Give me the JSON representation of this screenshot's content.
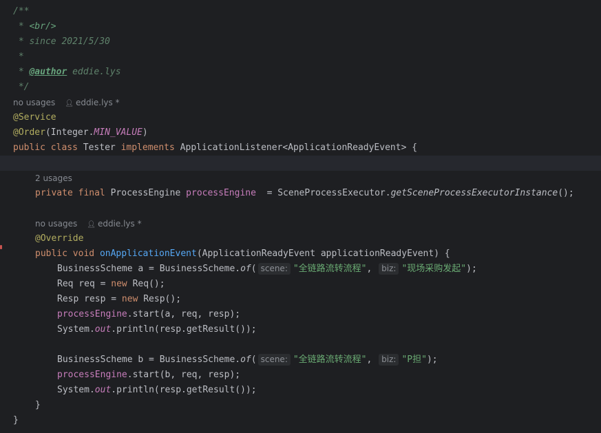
{
  "javadoc": {
    "open": "/**",
    "br_prefix": " * ",
    "br_tag": "<br/>",
    "since_line": " * since 2021/5/30",
    "blank_line": " *",
    "author_prefix": " * ",
    "author_tag": "@author",
    "author_value": " eddie.lys",
    "close": " */"
  },
  "class_inlay": {
    "usages": "no usages",
    "author": "eddie.lys *"
  },
  "annotations": {
    "service": "@Service",
    "order": "@Order",
    "order_paren_open": "(Integer.",
    "order_const": "MIN_VALUE",
    "order_paren_close": ")"
  },
  "class_decl": {
    "public": "public",
    "class": "class",
    "name": " Tester ",
    "implements": "implements",
    "rest": " ApplicationListener<ApplicationReadyEvent> {"
  },
  "field_inlay": {
    "usages": "2 usages"
  },
  "field_decl": {
    "private": "private",
    "final": "final",
    "type": " ProcessEngine ",
    "name": "processEngine",
    "assign": "  = SceneProcessExecutor.",
    "call": "getSceneProcessExecutorInstance",
    "end": "();"
  },
  "method_inlay": {
    "usages": "no usages",
    "author": "eddie.lys *"
  },
  "method": {
    "override": "@Override",
    "public": "public",
    "void": "void",
    "name": "onApplicationEvent",
    "params": "(ApplicationReadyEvent applicationReadyEvent) {"
  },
  "body": {
    "scheme_a_decl": "BusinessScheme a = BusinessScheme.",
    "of": "of",
    "paren_open": "(",
    "hint_scene": "scene:",
    "scene_value": "\"全链路流转流程\"",
    "comma": ", ",
    "hint_biz": "biz:",
    "biz_a_value": "\"现场采购发起\"",
    "call_end": ");",
    "req_decl_a": "Req req = ",
    "new": "new",
    "req_decl_b": " Req();",
    "resp_decl_a": "Resp resp = ",
    "resp_decl_b": " Resp();",
    "engine": "processEngine",
    "start_a": ".start(a, req, resp);",
    "system": "System.",
    "out": "out",
    "println": ".println(resp.getResult());",
    "scheme_b_decl": "BusinessScheme b = BusinessScheme.",
    "biz_b_value": "\"P担\"",
    "start_b": ".start(b, req, resp);",
    "method_close": "}",
    "class_close": "}"
  },
  "icons": {
    "author": "user-icon"
  },
  "colors": {
    "background": "#1e1f22",
    "keyword": "#cf8e6d",
    "annotation": "#b3ae60",
    "string": "#6aab73",
    "field": "#c77dbb",
    "method_declaration": "#56a8f5",
    "doc_comment": "#5f826b"
  }
}
